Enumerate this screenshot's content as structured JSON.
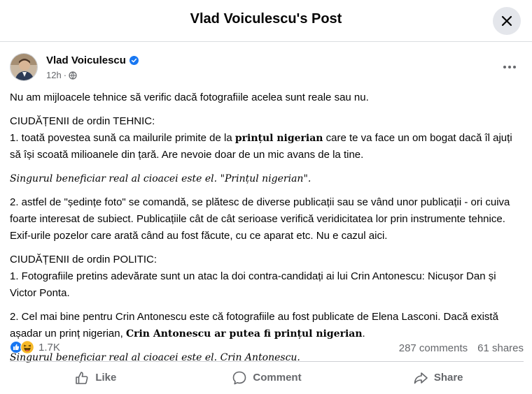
{
  "header": {
    "title": "Vlad Voiculescu's Post"
  },
  "post": {
    "author": "Vlad Voiculescu",
    "time": "12h",
    "intro": "Nu am mijloacele tehnice să verific dacă fotografiile acelea sunt reale sau nu.",
    "tech_heading": "CIUDĂȚENII de ordin TEHNIC:",
    "p1_pre": "1. toată povestea sună ca mailurile primite de la ",
    "p1_bold": "prințul nigerian",
    "p1_post": " care te va face un om bogat dacă îl ajuți să își scoată milioanele din țară. Are nevoie doar de un mic avans de la tine.",
    "italic1": "Singurul beneficiar real al cioacei este el. \"Prințul nigerian\".",
    "p2": "2. astfel de \"ședințe foto\" se comandă, se plătesc de diverse publicații sau se vând unor publicații - ori cuiva foarte interesat de subiect. Publicațiile cât de cât serioase verifică veridicitatea lor prin instrumente tehnice. Exif-urile pozelor care arată când au fost făcute, cu ce aparat etc. Nu e cazul aici.",
    "pol_heading": "CIUDĂȚENII de ordin POLITIC:",
    "p3": "1. Fotografiile pretins adevărate sunt un atac la doi contra-candidați ai lui Crin Antonescu: Nicușor Dan și Victor Ponta.",
    "p4_pre": "2. Cel mai bine pentru Crin Antonescu este că fotografiile au fost publicate de Elena Lasconi. Dacă există așadar un prinț nigerian, ",
    "p4_bold": "Crin Antonescu ar putea fi prințul nigerian",
    "p4_post": ".",
    "italic2": "Singurul beneficiar real al cioacei este el. Crin Antonescu."
  },
  "stats": {
    "reactions": "1.7K",
    "comments": "287 comments",
    "shares": "61 shares"
  },
  "actions": {
    "like": "Like",
    "comment": "Comment",
    "share": "Share"
  },
  "colors": {
    "verified": "#1877f2",
    "like": "#1877f2",
    "haha": "#f7b928",
    "secondary_text": "#65676b"
  },
  "icons": [
    "close-icon",
    "verified-badge-icon",
    "globe-icon",
    "more-icon",
    "like-reaction-icon",
    "haha-reaction-icon",
    "thumbs-up-icon",
    "comment-icon",
    "share-icon"
  ]
}
